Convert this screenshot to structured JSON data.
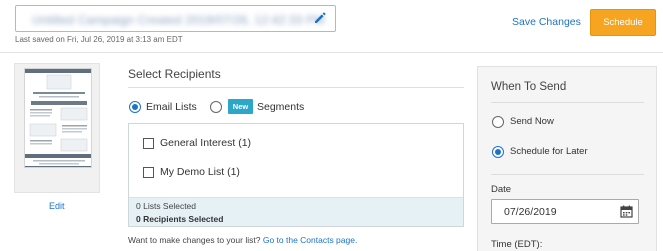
{
  "header": {
    "campaign_name": "Untitled Campaign Created 2019/07/26, 12:42:33 PM",
    "last_saved": "Last saved on Fri, Jul 26, 2019 at 3:13 am EDT",
    "save_changes_label": "Save Changes",
    "schedule_label": "Schedule"
  },
  "preview": {
    "edit_label": "Edit"
  },
  "recipients": {
    "title": "Select Recipients",
    "mode_options": [
      {
        "label": "Email Lists",
        "selected": true
      },
      {
        "label": "Segments",
        "selected": false,
        "badge": "New"
      }
    ],
    "lists": [
      {
        "label": "General Interest (1)",
        "checked": false
      },
      {
        "label": "My Demo List (1)",
        "checked": false
      }
    ],
    "lists_selected": "0 Lists Selected",
    "recipients_selected": "0 Recipients Selected",
    "changes_prompt": "Want to make changes to your list?",
    "contacts_link": "Go to the Contacts page."
  },
  "when_to_send": {
    "title": "When To Send",
    "options": [
      {
        "label": "Send Now",
        "selected": false
      },
      {
        "label": "Schedule for Later",
        "selected": true
      }
    ],
    "date_label": "Date",
    "date_value": "07/26/2019",
    "time_label": "Time (EDT):"
  },
  "colors": {
    "accent": "#1a73c9",
    "schedule_button": "#f7a520",
    "new_badge": "#2da7c7",
    "footer_bg": "#e6f1f6"
  },
  "icons": [
    "pencil-icon",
    "calendar-icon",
    "email-thumbnail"
  ]
}
